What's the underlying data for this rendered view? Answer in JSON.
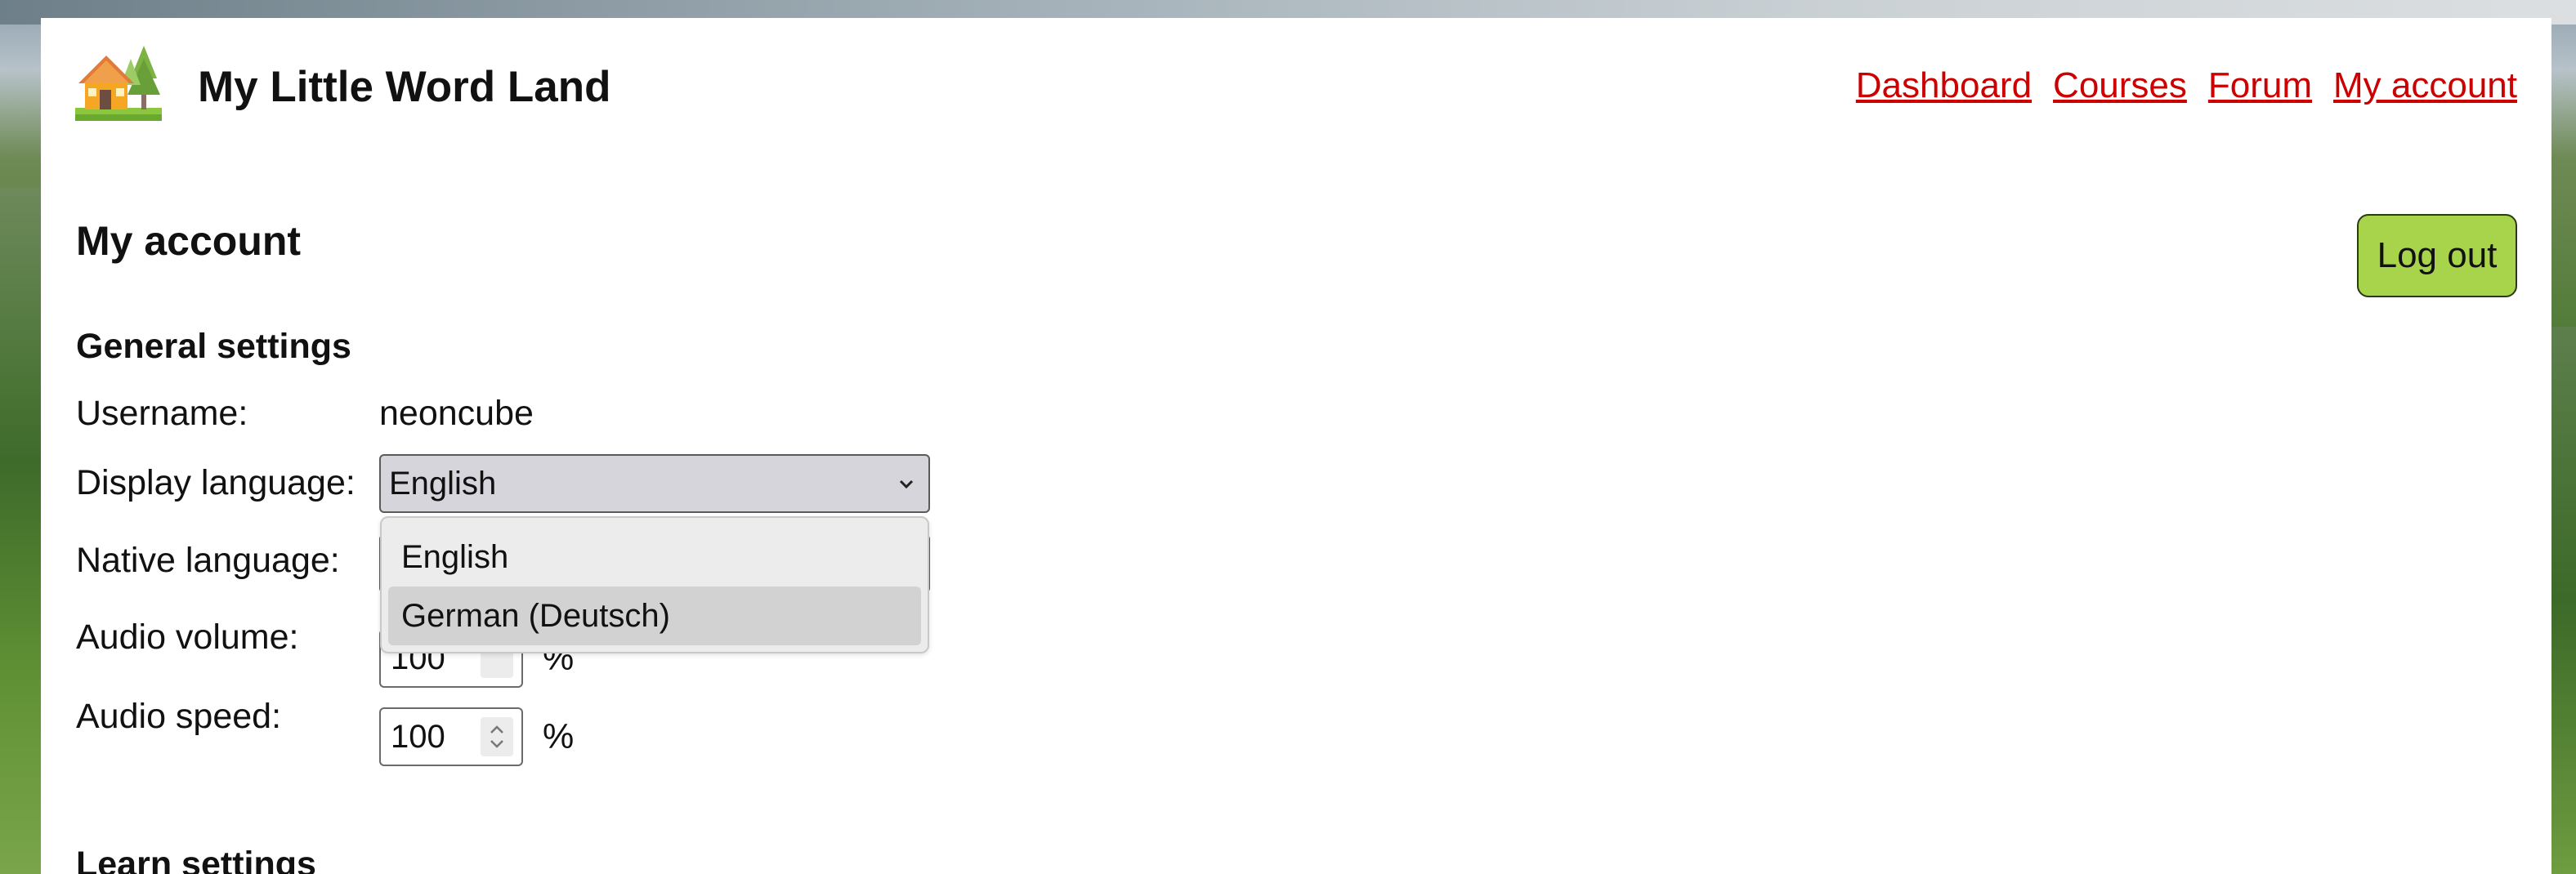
{
  "site": {
    "title": "My Little Word Land",
    "logo_icon": "house-trees-logo-icon"
  },
  "nav": {
    "items": [
      {
        "label": "Dashboard"
      },
      {
        "label": "Courses"
      },
      {
        "label": "Forum"
      },
      {
        "label": "My account"
      }
    ],
    "link_color": "#cc0000"
  },
  "page": {
    "title": "My account",
    "logout_label": "Log out",
    "logout_color": "#a8d44c"
  },
  "general": {
    "heading": "General settings",
    "username_label": "Username:",
    "username_value": "neoncube",
    "display_language_label": "Display language:",
    "display_language_value": "English",
    "native_language_label": "Native language:",
    "audio_volume_label": "Audio volume:",
    "audio_volume_value": "100",
    "audio_speed_label": "Audio speed:",
    "audio_speed_value": "100",
    "percent_unit": "%"
  },
  "dropdown": {
    "options": [
      "English",
      "German (Deutsch)"
    ],
    "highlighted_index": 1
  },
  "learn": {
    "heading": "Learn settings"
  }
}
